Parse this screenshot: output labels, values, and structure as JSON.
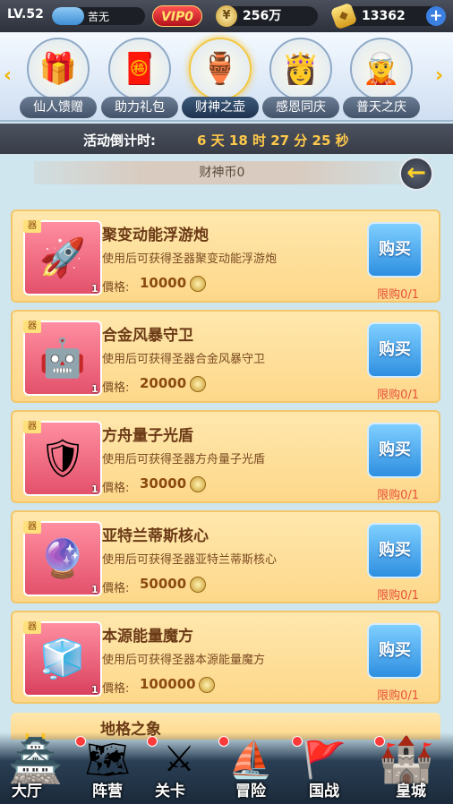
{
  "player": {
    "level": "LV.52",
    "name": "苦无",
    "level_progress": 0.35,
    "vip": "VIP0"
  },
  "currency": {
    "coins": "256万",
    "gold": "13362",
    "coin_icon": "coin-icon",
    "gold_icon": "gold-ingot-icon"
  },
  "tabs": [
    {
      "label": "仙人馈赠",
      "icon": "🎁"
    },
    {
      "label": "助力礼包",
      "icon": "🧧"
    },
    {
      "label": "财神之壶",
      "icon": "🏺",
      "active": true
    },
    {
      "label": "感恩同庆",
      "icon": "👸"
    },
    {
      "label": "普天之庆",
      "icon": "🧝"
    }
  ],
  "countdown": {
    "label": "活动倒计时:",
    "value": "6 天 18 时 27 分 25 秒"
  },
  "caishen_coins": "财神币0",
  "items": [
    {
      "tag": "器",
      "qty": "1",
      "name": "聚变动能浮游炮",
      "desc": "使用后可获得圣器聚变动能浮游炮",
      "price_label": "價格:",
      "price": "10000",
      "buy": "购买",
      "limit": "限购0/1",
      "icon": "🚀"
    },
    {
      "tag": "器",
      "qty": "1",
      "name": "合金风暴守卫",
      "desc": "使用后可获得圣器合金风暴守卫",
      "price_label": "價格:",
      "price": "20000",
      "buy": "购买",
      "limit": "限购0/1",
      "icon": "🤖"
    },
    {
      "tag": "器",
      "qty": "1",
      "name": "方舟量子光盾",
      "desc": "使用后可获得圣器方舟量子光盾",
      "price_label": "價格:",
      "price": "30000",
      "buy": "购买",
      "limit": "限购0/1",
      "icon": "🛡"
    },
    {
      "tag": "器",
      "qty": "1",
      "name": "亚特兰蒂斯核心",
      "desc": "使用后可获得圣器亚特兰蒂斯核心",
      "price_label": "價格:",
      "price": "50000",
      "buy": "购买",
      "limit": "限购0/1",
      "icon": "🔮"
    },
    {
      "tag": "器",
      "qty": "1",
      "name": "本源能量魔方",
      "desc": "使用后可获得圣器本源能量魔方",
      "price_label": "價格:",
      "price": "100000",
      "buy": "购买",
      "limit": "限购0/1",
      "icon": "🧊"
    }
  ],
  "next_item_peek": "地格之象",
  "nav": [
    {
      "label": "大厅",
      "icon": "🏯"
    },
    {
      "label": "阵营",
      "icon": "🗺"
    },
    {
      "label": "关卡",
      "icon": "⚔"
    },
    {
      "label": "冒险",
      "icon": "⛵"
    },
    {
      "label": "国战",
      "icon": "🚩"
    },
    {
      "label": "皇城",
      "icon": "🏰"
    }
  ]
}
